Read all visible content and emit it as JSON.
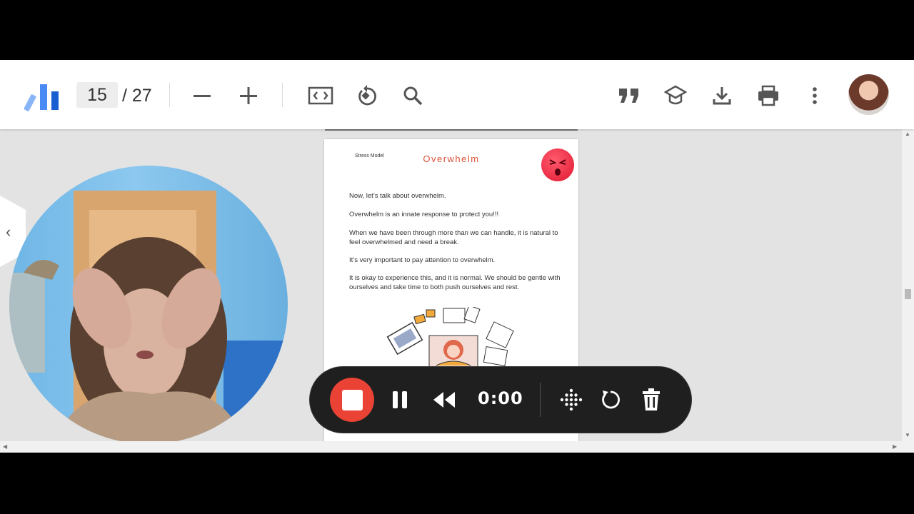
{
  "toolbar": {
    "current_page": "15",
    "total_pages": "/ 27",
    "icons": [
      "logo-icon",
      "zoom-out-icon",
      "zoom-in-icon",
      "fit-width-icon",
      "rotate-icon",
      "search-icon",
      "quote-icon",
      "cap-icon",
      "download-icon",
      "print-icon",
      "more-vert-icon",
      "avatar"
    ]
  },
  "document": {
    "label": "Stress Model",
    "title": "Overwhelm",
    "paragraphs": [
      "Now, let’s talk about overwhelm.",
      "Overwhelm is an innate response to protect you!!!",
      "When we have been through more than we can handle, it is natural to feel overwhelmed and need a break.",
      "It’s very important to pay attention to overwhelm.",
      "It is okay to experience this, and it is normal. We should be gentle with ourselves and take time to both push ourselves and rest."
    ]
  },
  "recorder": {
    "timer": "0:00"
  },
  "colors": {
    "accent_blue": "#4a8af4",
    "stop_red": "#ea4335",
    "title_orange": "#d9543a",
    "recorder_bg": "#1f1f1f"
  }
}
